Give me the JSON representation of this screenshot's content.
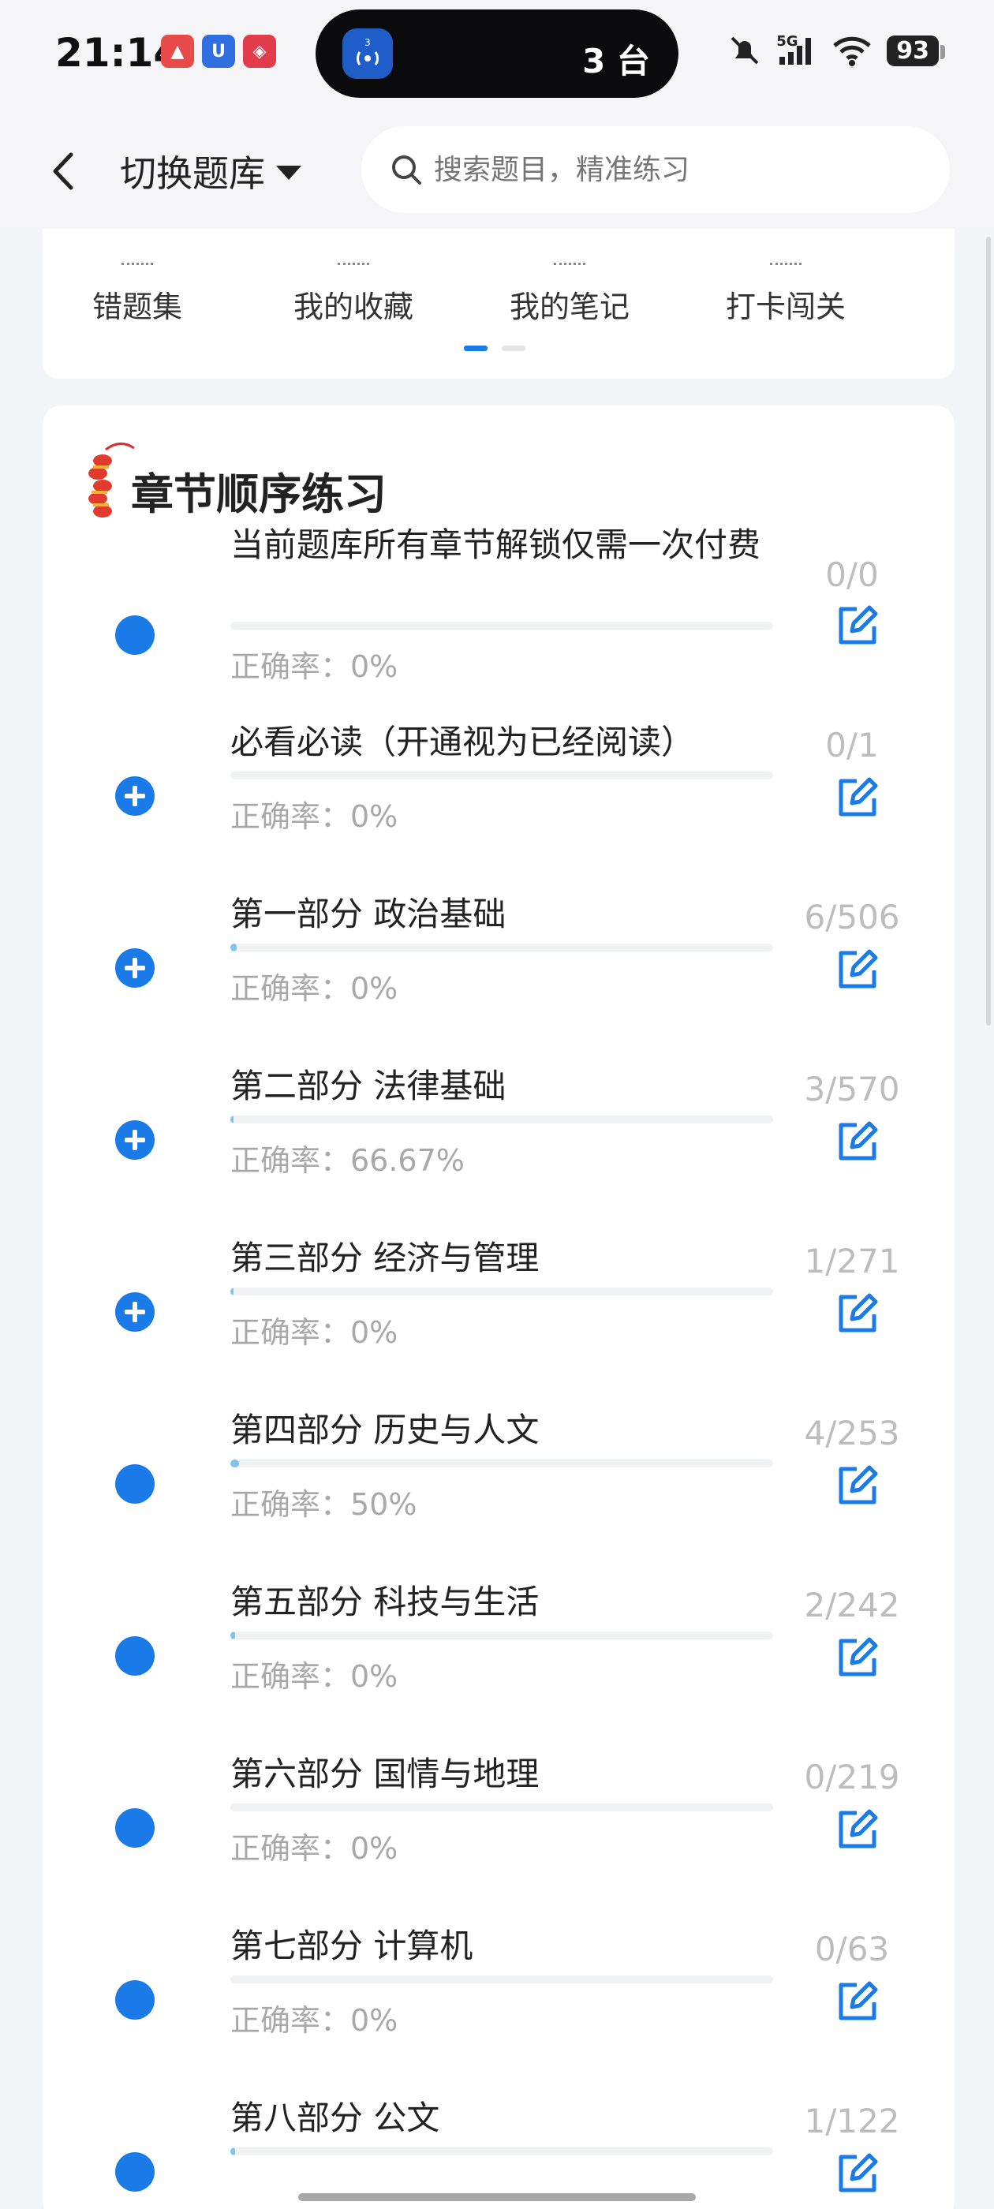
{
  "status_bar": {
    "time": "21:14",
    "pill_badge": "3",
    "pill_text": "3 台",
    "network": "5G",
    "battery": "93"
  },
  "header": {
    "switch_label": "切换题库",
    "search_placeholder": "搜索题目，精准练习"
  },
  "tools": [
    {
      "label": "错题集",
      "icon": "wrong-book-icon"
    },
    {
      "label": "我的收藏",
      "icon": "favorite-icon"
    },
    {
      "label": "我的笔记",
      "icon": "notes-icon"
    },
    {
      "label": "打卡闯关",
      "icon": "checkin-icon"
    }
  ],
  "section": {
    "title": "章节顺序练习"
  },
  "chapters": [
    {
      "title": "当前题库所有章节解锁仅需一次付费",
      "accuracy": "正确率：0%",
      "count": "0/0",
      "progress": 0,
      "expandable": false
    },
    {
      "title": "必看必读（开通视为已经阅读）",
      "accuracy": "正确率：0%",
      "count": "0/1",
      "progress": 0,
      "expandable": true
    },
    {
      "title": "第一部分 政治基础",
      "accuracy": "正确率：0%",
      "count": "6/506",
      "progress": 0.012,
      "expandable": true
    },
    {
      "title": "第二部分 法律基础",
      "accuracy": "正确率：66.67%",
      "count": "3/570",
      "progress": 0.005,
      "expandable": true
    },
    {
      "title": "第三部分 经济与管理",
      "accuracy": "正确率：0%",
      "count": "1/271",
      "progress": 0.004,
      "expandable": true
    },
    {
      "title": "第四部分 历史与人文",
      "accuracy": "正确率：50%",
      "count": "4/253",
      "progress": 0.016,
      "expandable": false
    },
    {
      "title": "第五部分 科技与生活",
      "accuracy": "正确率：0%",
      "count": "2/242",
      "progress": 0.008,
      "expandable": false
    },
    {
      "title": "第六部分 国情与地理",
      "accuracy": "正确率：0%",
      "count": "0/219",
      "progress": 0,
      "expandable": false
    },
    {
      "title": "第七部分 计算机",
      "accuracy": "正确率：0%",
      "count": "0/63",
      "progress": 0,
      "expandable": false
    },
    {
      "title": "第八部分 公文",
      "accuracy": "",
      "count": "1/122",
      "progress": 0.008,
      "expandable": false
    }
  ],
  "colors": {
    "accent": "#1a7be8",
    "progress_fill": "#7fc3f0",
    "muted_text": "#a8a8a8"
  }
}
